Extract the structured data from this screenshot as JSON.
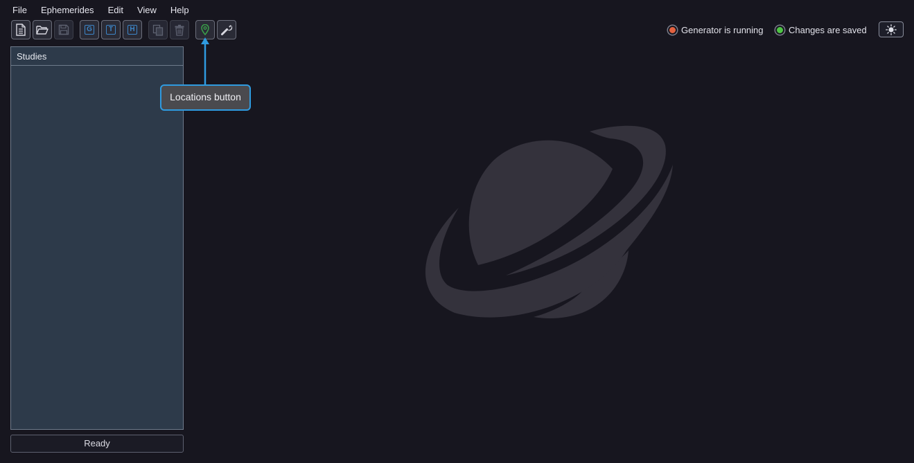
{
  "menu": {
    "items": [
      {
        "label": "File"
      },
      {
        "label": "Ephemerides"
      },
      {
        "label": "Edit"
      },
      {
        "label": "View"
      },
      {
        "label": "Help"
      }
    ]
  },
  "toolbar": {
    "new_icon": "new-file-icon",
    "open_icon": "open-folder-icon",
    "save_icon": "save-icon",
    "g_label": "G",
    "t_label": "T",
    "h_label": "H",
    "copy_icon": "copy-icon",
    "delete_icon": "trash-icon",
    "locations_icon": "map-pin-icon",
    "settings_icon": "wrench-icon",
    "accent_color": "#3d86c8",
    "pin_color": "#3aa04a"
  },
  "status": {
    "generator_label": "Generator is running",
    "generator_color": "#e36240",
    "saved_label": "Changes are saved",
    "saved_color": "#4ec545",
    "theme_icon": "sun-icon"
  },
  "studies": {
    "header": "Studies"
  },
  "statusbar": {
    "text": "Ready"
  },
  "annotation": {
    "text": "Locations button",
    "border_color": "#2f9be0"
  },
  "logo": {
    "icon": "saturn-planet-logo"
  }
}
